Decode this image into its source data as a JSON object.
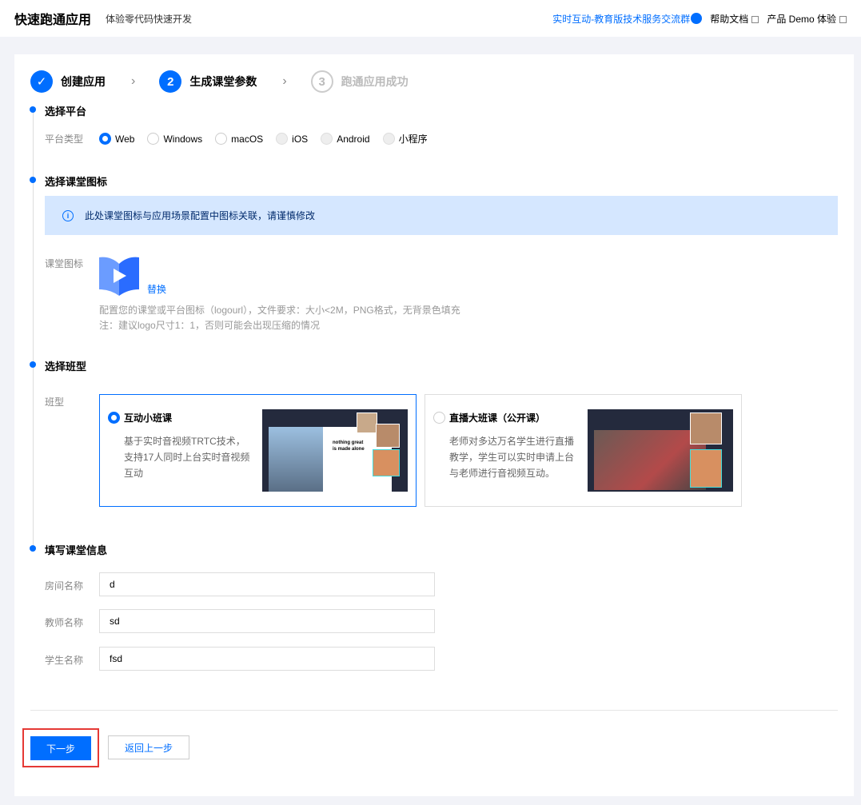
{
  "header": {
    "title": "快速跑通应用",
    "subtitle": "体验零代码快速开发",
    "links": [
      "实时互动-教育版技术服务交流群",
      "帮助文档",
      "产品 Demo 体验"
    ]
  },
  "steps": [
    {
      "num": "✓",
      "label": "创建应用"
    },
    {
      "num": "2",
      "label": "生成课堂参数"
    },
    {
      "num": "3",
      "label": "跑通应用成功"
    }
  ],
  "platform": {
    "section": "选择平台",
    "label": "平台类型",
    "options": [
      "Web",
      "Windows",
      "macOS",
      "iOS",
      "Android",
      "小程序"
    ],
    "selected": "Web"
  },
  "icon_section": {
    "section": "选择课堂图标",
    "notice": "此处课堂图标与应用场景配置中图标关联，请谨慎修改",
    "label": "课堂图标",
    "replace": "替换",
    "hint1": "配置您的课堂或平台图标（logourl），文件要求：大小<2M，PNG格式，无背景色填充",
    "hint2": "注：建议logo尺寸1：1，否则可能会出现压缩的情况"
  },
  "class_type": {
    "section": "选择班型",
    "label": "班型",
    "options": [
      {
        "title": "互动小班课",
        "desc": "基于实时音视频TRTC技术，支持17人同时上台实时音视频互动",
        "thumb_text": "nothing great is made alone",
        "selected": true
      },
      {
        "title": "直播大班课（公开课）",
        "desc": "老师对多达万名学生进行直播教学，学生可以实时申请上台与老师进行音视频互动。",
        "selected": false
      }
    ]
  },
  "info": {
    "section": "填写课堂信息",
    "fields": [
      {
        "label": "房间名称",
        "value": "d"
      },
      {
        "label": "教师名称",
        "value": "sd"
      },
      {
        "label": "学生名称",
        "value": "fsd"
      }
    ]
  },
  "buttons": {
    "next": "下一步",
    "back": "返回上一步"
  }
}
